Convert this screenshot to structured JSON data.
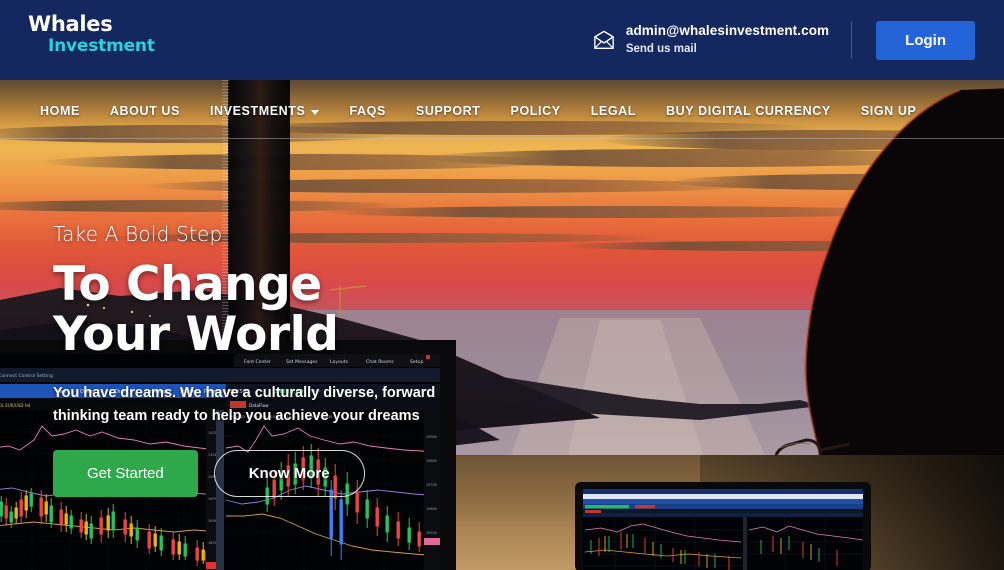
{
  "brand": {
    "line1": "Whales",
    "line2": "Investment",
    "accent_color": "#27d3dd",
    "header_bg": "#14285f"
  },
  "topbar": {
    "mail_icon": "envelope-icon",
    "email": "admin@whalesinvestment.com",
    "email_caption": "Send us mail",
    "login_label": "Login",
    "login_color": "#2563d9"
  },
  "nav": {
    "items": [
      {
        "label": "HOME",
        "has_dropdown": false
      },
      {
        "label": "ABOUT US",
        "has_dropdown": false
      },
      {
        "label": "INVESTMENTS",
        "has_dropdown": true
      },
      {
        "label": "FAQS",
        "has_dropdown": false
      },
      {
        "label": "SUPPORT",
        "has_dropdown": false
      },
      {
        "label": "POLICY",
        "has_dropdown": false
      },
      {
        "label": "LEGAL",
        "has_dropdown": false
      },
      {
        "label": "BUY DIGITAL CURRENCY",
        "has_dropdown": false
      },
      {
        "label": "SIGN UP",
        "has_dropdown": false
      }
    ]
  },
  "hero": {
    "eyebrow": "Take A Bold Step",
    "headline": "To Change Your World",
    "subcopy": "You have dreams. We have a culturally diverse, forward thinking team ready to help you achieve your dreams",
    "primary_cta": "Get Started",
    "primary_cta_color": "#2fa84b",
    "secondary_cta": "Know More",
    "background_description": "Sunset over a coastal bay with silhouetted person wearing glasses and trading monitors showing candlestick charts"
  }
}
